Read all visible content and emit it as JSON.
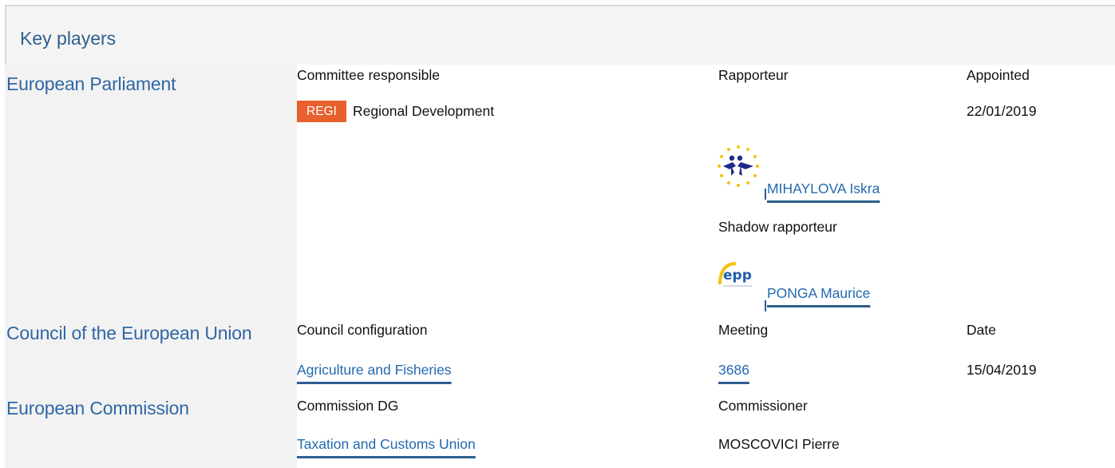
{
  "header": {
    "title": "Key players"
  },
  "parliament": {
    "label": "European Parliament",
    "committee_header": "Committee responsible",
    "rapporteur_header": "Rapporteur",
    "appointed_header": "Appointed",
    "committee_code": "REGI",
    "committee_name": "Regional Development",
    "appointed_date": "22/01/2019",
    "rapporteur_name": "MIHAYLOVA Iskra",
    "rapporteur_group_icon": "renew-europe-logo",
    "shadow_header": "Shadow rapporteur",
    "shadow_name": "PONGA Maurice",
    "shadow_group_icon": "epp-logo",
    "shadow_logo_text": "epp",
    "badge_color": "#e8602d"
  },
  "council": {
    "label": "Council of the European Union",
    "config_header": "Council configuration",
    "meeting_header": "Meeting",
    "date_header": "Date",
    "configuration": "Agriculture and Fisheries",
    "meeting": "3686",
    "date": "15/04/2019"
  },
  "commission": {
    "label": "European Commission",
    "dg_header": "Commission DG",
    "commissioner_header": "Commissioner",
    "dg": "Taxation and Customs Union",
    "commissioner": "MOSCOVICI Pierre"
  },
  "colors": {
    "institution_text": "#2f67a5",
    "link": "#2369b0",
    "header_bg": "#f4f4f4",
    "left_column_bg": "#f2f2f2"
  }
}
